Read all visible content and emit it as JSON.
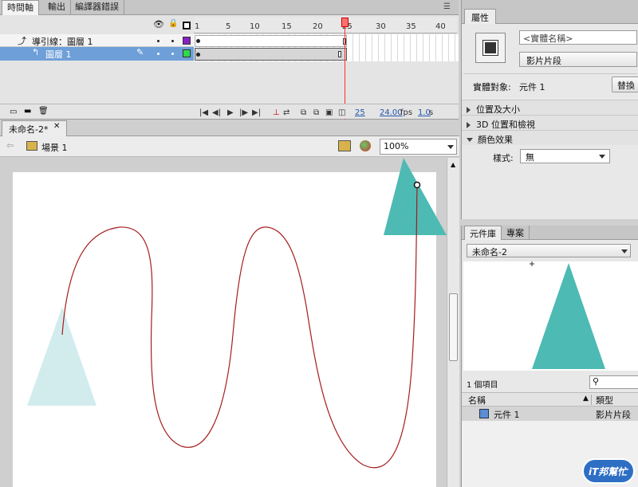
{
  "timeline_panel": {
    "tabs": [
      "時間軸",
      "輸出",
      "編譯器錯誤"
    ],
    "frame_numbers": [
      "1",
      "5",
      "10",
      "15",
      "20",
      "25",
      "30",
      "35",
      "40"
    ],
    "layers": [
      {
        "name": "導引線：圖層 1",
        "color": "#8b1fc4"
      },
      {
        "name": "圖層 1",
        "color": "#2fd84a"
      }
    ],
    "current_frame": "25",
    "fps": "24.00",
    "fps_unit": "fps",
    "elapsed": "1.0",
    "elapsed_unit": "s"
  },
  "document": {
    "tab": "未命名-2*",
    "scene_label": "場景 1",
    "zoom": "100%"
  },
  "properties_panel": {
    "title": "屬性",
    "instance_name_placeholder": "<實體名稱>",
    "symbol_type": "影片片段",
    "instance_of_label": "實體對象:",
    "instance_of_value": "元件 1",
    "swap_button": "替換",
    "sections": [
      "位置及大小",
      "3D 位置和檢視",
      "顏色效果"
    ],
    "style_label": "樣式:",
    "style_value": "無"
  },
  "library_panel": {
    "tabs": [
      "元件庫",
      "專案"
    ],
    "document": "未命名-2",
    "item_count": "1 個項目",
    "columns": [
      "名稱",
      "類型"
    ],
    "items": [
      {
        "name": "元件 1",
        "type": "影片片段"
      }
    ]
  },
  "watermark": {
    "text": "iT邦幫忙"
  },
  "colors": {
    "teal": "#4dbab4",
    "faded_teal": "#d2ecee",
    "guide_path": "#a51c1c",
    "playhead": "#ff3030"
  }
}
